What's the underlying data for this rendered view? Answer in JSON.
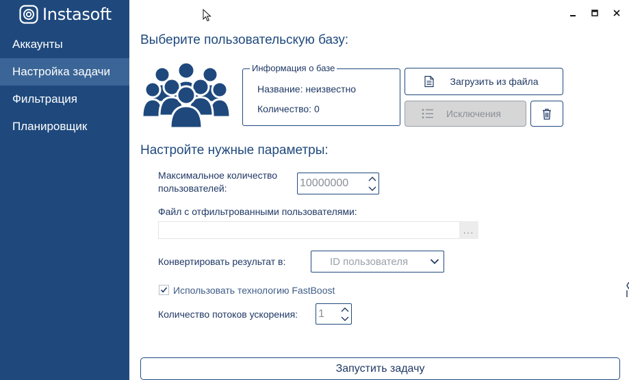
{
  "app": {
    "logo_text": "Instasoft"
  },
  "sidebar": {
    "items": [
      {
        "label": "Аккаунты",
        "active": false
      },
      {
        "label": "Настройка задачи",
        "active": true
      },
      {
        "label": "Фильтрация",
        "active": false
      },
      {
        "label": "Планировщик",
        "active": false
      }
    ]
  },
  "window_controls": [
    "minimize-icon",
    "maximize-icon",
    "close-icon"
  ],
  "main": {
    "select_base_title": "Выберите пользовательскую базу:",
    "base_info": {
      "legend": "Информация о базе",
      "name_line": "Название: неизвестно",
      "count_line": "Количество: 0"
    },
    "load_button_label": "Загрузить из файла",
    "exclusions_button_label": "Исключения",
    "params_title": "Настройте нужные параметры:",
    "max_users_label_line1": "Максимальное количество",
    "max_users_label_line2": "пользователей:",
    "max_users_value": "10000000",
    "filtered_file_label": "Файл с отфильтрованными пользователями:",
    "filtered_file_value": "",
    "browse_label": "...",
    "convert_label": "Конвертировать результат в:",
    "convert_selected": "ID пользователя",
    "fastboost_label": "Использовать технологию FastBoost",
    "fastboost_checked": true,
    "threads_label": "Количество потоков ускорения:",
    "threads_value": "1",
    "run_button_label": "Запустить задачу"
  },
  "colors": {
    "sidebar_bg": "#1f497d",
    "sidebar_active": "#3a6596",
    "accent": "#1f497d",
    "disabled_bg": "#d6d6d6"
  }
}
